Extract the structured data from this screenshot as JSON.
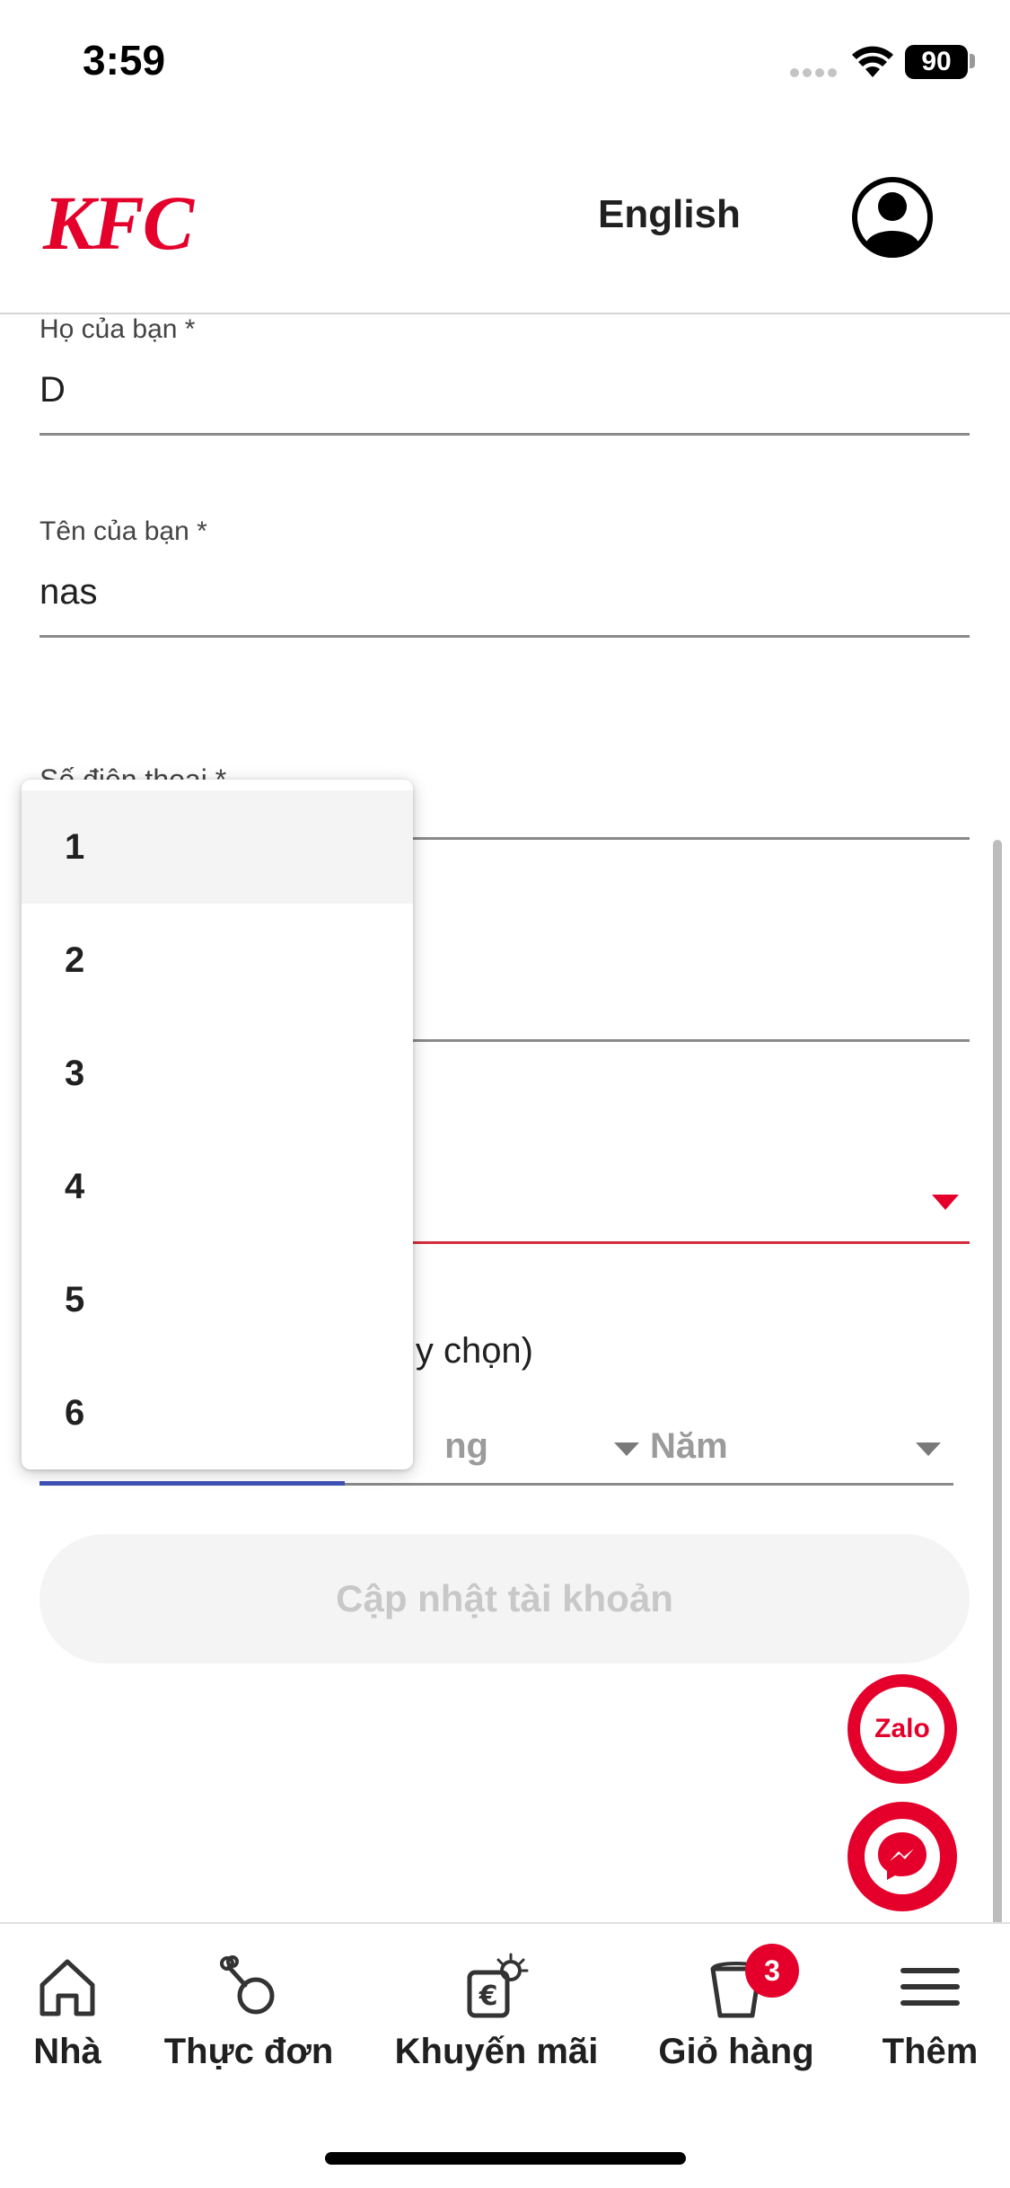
{
  "status_bar": {
    "time": "3:59",
    "battery": "90"
  },
  "header": {
    "logo": "KFC",
    "language": "English"
  },
  "form": {
    "last_name": {
      "label": "Họ của bạn *",
      "value": "D"
    },
    "first_name": {
      "label": "Tên của bạn *",
      "value": "nas"
    },
    "phone": {
      "label": "Số điện thoại *"
    },
    "dob": {
      "label_visible": "y chọn)",
      "month_visible": "ng",
      "year_placeholder": "Năm"
    },
    "update_button": "Cập nhật tài khoản"
  },
  "dropdown": {
    "options": [
      "1",
      "2",
      "3",
      "4",
      "5",
      "6"
    ],
    "highlighted": "1"
  },
  "chat": {
    "zalo": "Zalo"
  },
  "bottom_nav": {
    "home": "Nhà",
    "menu": "Thực đơn",
    "promo": "Khuyến mãi",
    "cart": "Giỏ hàng",
    "cart_count": "3",
    "more": "Thêm"
  },
  "colors": {
    "brand_red": "#e4002b",
    "focus_blue": "#3f51b5"
  }
}
